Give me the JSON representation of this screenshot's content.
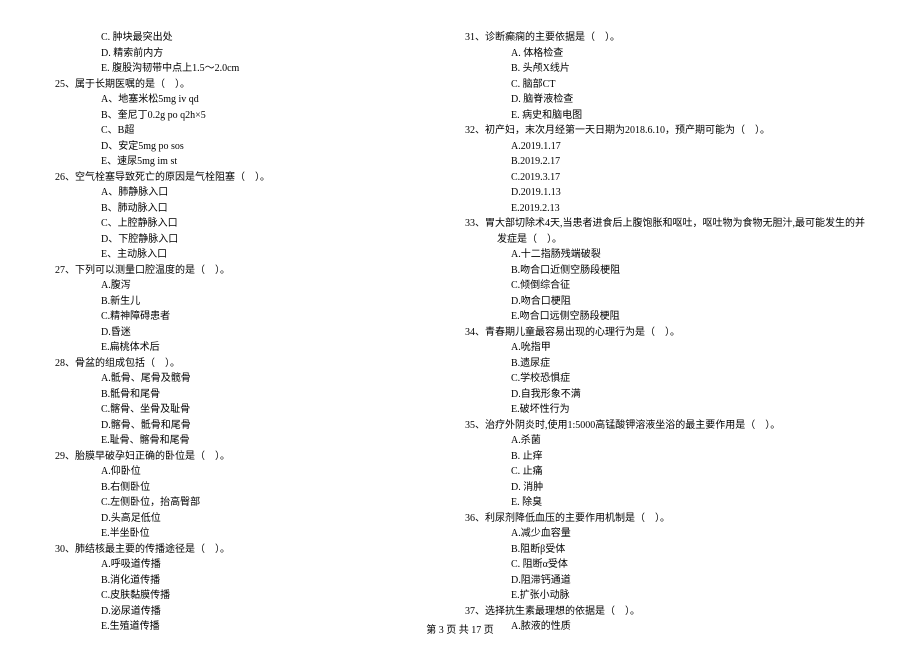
{
  "left": {
    "q24": {
      "c": "C. 肿块最突出处",
      "d": "D. 精索前内方",
      "e": "E. 腹股沟韧带中点上1.5～2.0cm"
    },
    "q25": {
      "stem": "25、属于长期医嘱的是（    ）。",
      "a": "A、地塞米松5mg iv qd",
      "b": "B、奎尼丁0.2g po q2h×5",
      "c": "C、B超",
      "d": "D、安定5mg po sos",
      "e": "E、速尿5mg im st"
    },
    "q26": {
      "stem": "26、空气栓塞导致死亡的原因是气栓阻塞（    ）。",
      "a": "A、肺静脉入口",
      "b": "B、肺动脉入口",
      "c": "C、上腔静脉入口",
      "d": "D、下腔静脉入口",
      "e": "E、主动脉入口"
    },
    "q27": {
      "stem": "27、下列可以测量口腔温度的是（    ）。",
      "a": "A.腹泻",
      "b": "B.新生儿",
      "c": "C.精神障碍患者",
      "d": "D.昏迷",
      "e": "E.扁桃体术后"
    },
    "q28": {
      "stem": "28、骨盆的组成包括（    ）。",
      "a": "A.骶骨、尾骨及髋骨",
      "b": "B.骶骨和尾骨",
      "c": "C.髂骨、坐骨及耻骨",
      "d": "D.髂骨、骶骨和尾骨",
      "e": "E.耻骨、髂骨和尾骨"
    },
    "q29": {
      "stem": "29、胎膜早破孕妇正确的卧位是（    ）。",
      "a": "A.仰卧位",
      "b": "B.右侧卧位",
      "c": "C.左侧卧位，抬高臀部",
      "d": "D.头高足低位",
      "e": "E.半坐卧位"
    },
    "q30": {
      "stem": "30、肺结核最主要的传播途径是（    ）。",
      "a": "A.呼吸道传播",
      "b": "B.消化道传播",
      "c": "C.皮肤黏膜传播",
      "d": "D.泌尿道传播",
      "e": "E.生殖道传播"
    }
  },
  "right": {
    "q31": {
      "stem": "31、诊断癫痫的主要依据是（    ）。",
      "a": "A. 体格检查",
      "b": "B. 头颅X线片",
      "c": "C. 脑部CT",
      "d": "D. 脑脊液检查",
      "e": "E. 病史和脑电图"
    },
    "q32": {
      "stem": "32、初产妇，末次月经第一天日期为2018.6.10，预产期可能为（    ）。",
      "a": "A.2019.1.17",
      "b": "B.2019.2.17",
      "c": "C.2019.3.17",
      "d": "D.2019.1.13",
      "e": "E.2019.2.13"
    },
    "q33": {
      "stem1": "33、胃大部切除术4天,当患者进食后上腹饱胀和呕吐，呕吐物为食物无胆汁,最可能发生的并",
      "stem2": "发症是（    ）。",
      "a": "A.十二指肠残端破裂",
      "b": "B.吻合口近侧空肠段梗阻",
      "c": "C.倾倒综合征",
      "d": "D.吻合口梗阻",
      "e": "E.吻合口远侧空肠段梗阻"
    },
    "q34": {
      "stem": "34、青春期儿童最容易出现的心理行为是（    ）。",
      "a": "A.吮指甲",
      "b": "B.遗尿症",
      "c": "C.学校恐惧症",
      "d": "D.自我形象不满",
      "e": "E.破坏性行为"
    },
    "q35": {
      "stem": "35、治疗外阴炎时,使用1:5000高锰酸钾溶液坐浴的最主要作用是（    ）。",
      "a": "A.杀菌",
      "b": "B. 止痒",
      "c": "C. 止痛",
      "d": "D. 消肿",
      "e": "E. 除臭"
    },
    "q36": {
      "stem": "36、利尿剂降低血压的主要作用机制是（    ）。",
      "a": "A.减少血容量",
      "b": "B.阻断β受体",
      "c": "C. 阻断α受体",
      "d": "D.阻滞钙通道",
      "e": "E.扩张小动脉"
    },
    "q37": {
      "stem": "37、选择抗生素最理想的依据是（    ）。",
      "a": "A.脓液的性质"
    }
  },
  "footer": "第 3 页 共 17 页"
}
